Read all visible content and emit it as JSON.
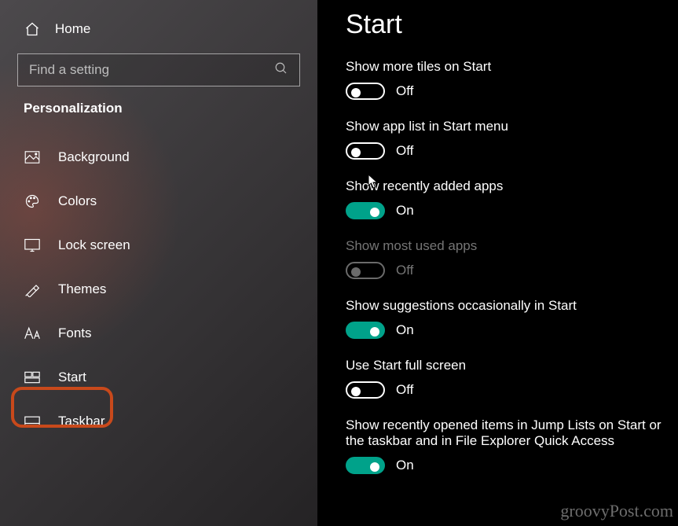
{
  "sidebar": {
    "home": "Home",
    "search_placeholder": "Find a setting",
    "category": "Personalization",
    "items": [
      {
        "label": "Background"
      },
      {
        "label": "Colors"
      },
      {
        "label": "Lock screen"
      },
      {
        "label": "Themes"
      },
      {
        "label": "Fonts"
      },
      {
        "label": "Start"
      },
      {
        "label": "Taskbar"
      }
    ]
  },
  "main": {
    "title": "Start",
    "settings": [
      {
        "label": "Show more tiles on Start",
        "state": "Off",
        "on": false,
        "disabled": false
      },
      {
        "label": "Show app list in Start menu",
        "state": "Off",
        "on": false,
        "disabled": false
      },
      {
        "label": "Show recently added apps",
        "state": "On",
        "on": true,
        "disabled": false
      },
      {
        "label": "Show most used apps",
        "state": "Off",
        "on": false,
        "disabled": true
      },
      {
        "label": "Show suggestions occasionally in Start",
        "state": "On",
        "on": true,
        "disabled": false
      },
      {
        "label": "Use Start full screen",
        "state": "Off",
        "on": false,
        "disabled": false
      },
      {
        "label": "Show recently opened items in Jump Lists on Start or the taskbar and in File Explorer Quick Access",
        "state": "On",
        "on": true,
        "disabled": false
      }
    ]
  },
  "watermark": "groovyPost.com"
}
